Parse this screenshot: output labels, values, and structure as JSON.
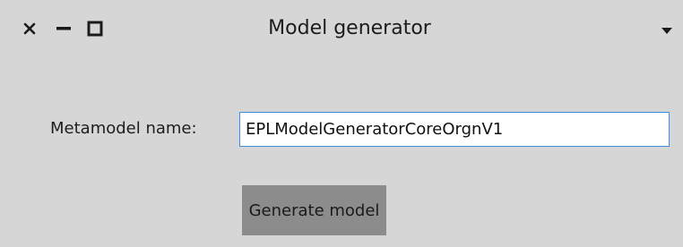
{
  "window": {
    "title": "Model generator",
    "controls": {
      "close_icon": "close-icon",
      "minimize_icon": "minimize-icon",
      "maximize_icon": "maximize-icon",
      "menu_icon": "dropdown-arrow-icon"
    }
  },
  "form": {
    "metamodel_label": "Metamodel name:",
    "metamodel_value": "EPLModelGeneratorCoreOrgnV1",
    "generate_label": "Generate model"
  },
  "colors": {
    "background": "#d6d6d6",
    "input_border_focus": "#3c8fe0",
    "button_bg": "#8c8c8c",
    "text": "#1c1c1c"
  }
}
